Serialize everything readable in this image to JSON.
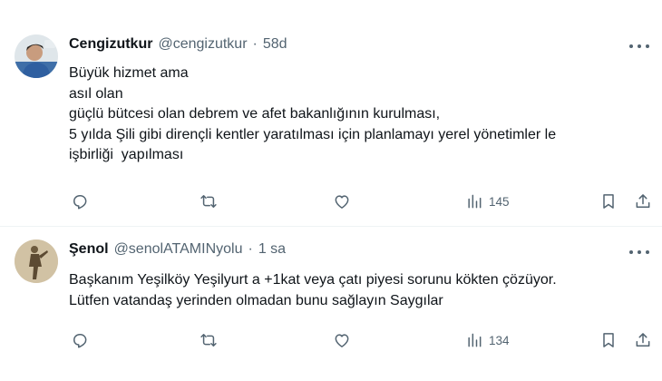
{
  "tweets": [
    {
      "author_name": "Cengizutkur",
      "author_handle": "@cengizutkur",
      "separator": "·",
      "time": "58d",
      "lines": [
        "Büyük hizmet ama",
        "asıl olan",
        "güçlü bütcesi olan debrem ve afet bakanlığının kurulması,",
        "5 yılda Şili gibi dirençli kentler yaratılması için planlamayı yerel yönetimler le",
        "işbirliği  yapılması"
      ],
      "views": "145"
    },
    {
      "author_name": "Şenol",
      "author_handle": "@senolATAMINyolu",
      "separator": "·",
      "time": "1 sa",
      "lines": [
        "Başkanım Yeşilköy Yeşilyurt a +1kat veya çatı piyesi sorunu kökten çözüyor.",
        "Lütfen vatandaş yerinden olmadan bunu sağlayın Saygılar"
      ],
      "views": "134"
    }
  ],
  "icons": {
    "reply": "reply-icon",
    "retweet": "retweet-icon",
    "like": "like-icon",
    "views": "views-icon",
    "bookmark": "bookmark-icon",
    "share": "share-icon",
    "more": "more-icon"
  },
  "colors": {
    "text_primary": "#0f1419",
    "text_secondary": "#536471",
    "divider": "#eff3f4",
    "background": "#ffffff"
  }
}
